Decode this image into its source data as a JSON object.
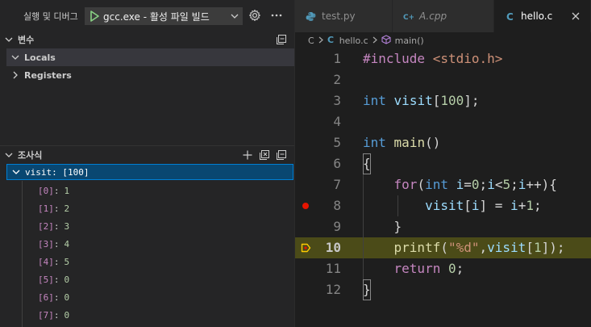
{
  "run_bar": {
    "title": "실행 및 디버그",
    "config": "gcc.exe - 활성 파일 빌드"
  },
  "variables": {
    "title": "변수",
    "locals": "Locals",
    "registers": "Registers"
  },
  "watch": {
    "title": "조사식",
    "root": "visit: [100]",
    "items": [
      {
        "key": "[0]",
        "value": "1"
      },
      {
        "key": "[1]",
        "value": "2"
      },
      {
        "key": "[2]",
        "value": "3"
      },
      {
        "key": "[3]",
        "value": "4"
      },
      {
        "key": "[4]",
        "value": "5"
      },
      {
        "key": "[5]",
        "value": "0"
      },
      {
        "key": "[6]",
        "value": "0"
      },
      {
        "key": "[7]",
        "value": "0"
      }
    ]
  },
  "tabs": [
    {
      "name": "test.py",
      "icon": "python-icon"
    },
    {
      "name": "A.cpp",
      "icon": "cpp-icon"
    },
    {
      "name": "hello.c",
      "icon": "c-icon"
    }
  ],
  "breadcrumb": {
    "folder": "C",
    "file": "hello.c",
    "symbol": "main()"
  },
  "editor": {
    "current_line": 10,
    "breakpoint_line": 8,
    "line_numbers": [
      "1",
      "2",
      "3",
      "4",
      "5",
      "6",
      "7",
      "8",
      "9",
      "10",
      "11",
      "12"
    ]
  },
  "colors": {
    "accent": "#007fd4",
    "selection": "#094771",
    "current_line": "#4b4b18",
    "breakpoint": "#e51400",
    "debug_arrow": "#ffcc00"
  }
}
